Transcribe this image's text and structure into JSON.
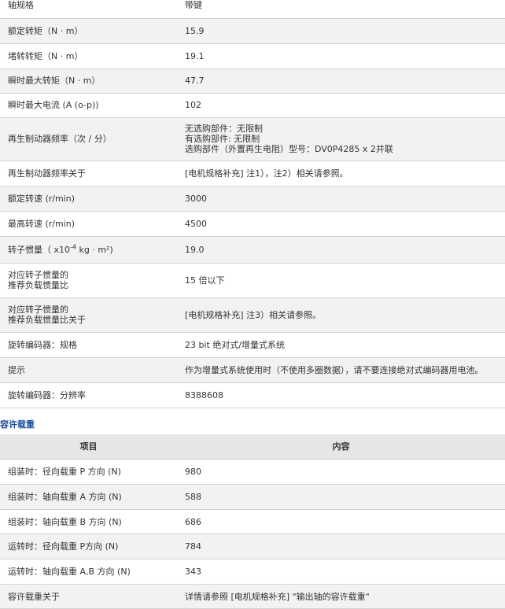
{
  "spec_rows": [
    {
      "label": "轴规格",
      "value": "带键"
    },
    {
      "label": "额定转矩（N · m）",
      "value": "15.9"
    },
    {
      "label": "堵转转矩（N · m）",
      "value": "19.1"
    },
    {
      "label": "瞬时最大转矩（N · m）",
      "value": "47.7"
    },
    {
      "label": "瞬时最大电流 (A (o-p))",
      "value": "102"
    },
    {
      "label": "再生制动器频率（次 / 分）",
      "value_lines": [
        "无选购部件：无限制",
        "有选购部件: 无限制",
        "选购部件（外置再生电阻）型号：DV0P4285 x 2并联"
      ]
    },
    {
      "label": "再生制动器频率关于",
      "value": "[电机规格补充] 注1），注2）相关请参照。"
    },
    {
      "label": "额定转速 (r/min)",
      "value": "3000"
    },
    {
      "label": "最高转速 (r/min)",
      "value": "4500"
    },
    {
      "label_pre": "转子惯量（ x10",
      "label_sup": "-4",
      "label_post": " kg · m²)",
      "value": "19.0"
    },
    {
      "label_lines": [
        "对应转子惯量的",
        "推荐负载惯量比"
      ],
      "value": "15 倍以下"
    },
    {
      "label_lines": [
        "对应转子惯量的",
        "推荐负载惯量比关于"
      ],
      "value": "[电机规格补充] 注3）相关请参照。"
    },
    {
      "label": "旋转编码器：规格",
      "value": "23 bit 绝对式/增量式系统"
    },
    {
      "label": "提示",
      "value": "作为增量式系统使用时（不使用多圈数据），请不要连接绝对式编码器用电池。"
    },
    {
      "label": "旋转编码器：分辨率",
      "value": "8388608"
    }
  ],
  "section_title": "容许载重",
  "load_table": {
    "headers": [
      "项目",
      "内容"
    ],
    "rows": [
      {
        "label": "组装时：径向载重 P 方向 (N)",
        "value": "980"
      },
      {
        "label": "组装时：轴向载重 A 方向 (N)",
        "value": "588"
      },
      {
        "label": "组装时：轴向载重 B 方向 (N)",
        "value": "686"
      },
      {
        "label": "运转时：径向载重 P方向 (N)",
        "value": "784"
      },
      {
        "label": "运转时：轴向载重 A,B 方向 (N)",
        "value": "343"
      },
      {
        "label": "容许载重关于",
        "value": "详情请参照 [电机规格补充] \"输出轴的容许载重\""
      }
    ]
  }
}
